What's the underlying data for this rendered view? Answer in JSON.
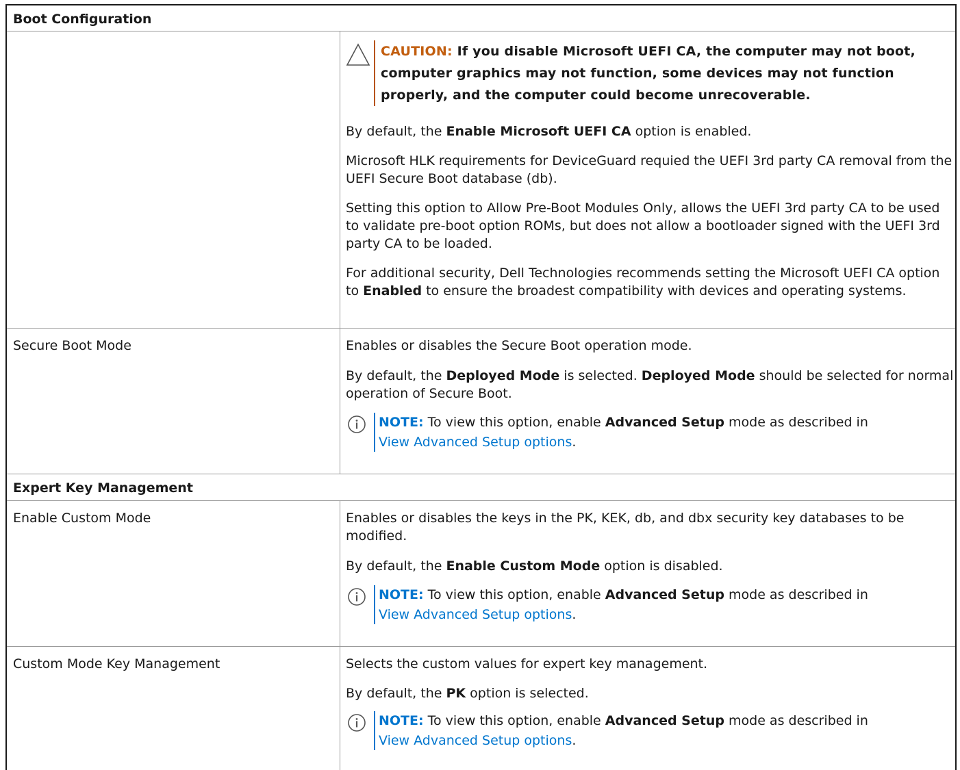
{
  "sections": {
    "boot_config_title": "Boot Configuration",
    "expert_key_title": "Expert Key Management"
  },
  "microsoft_uefi": {
    "caution_label": "CAUTION:",
    "caution_text": "If you disable Microsoft UEFI CA, the computer may not boot, computer graphics may not function, some devices may not function properly, and the computer could become unrecoverable.",
    "p1_pre": "By default, the ",
    "p1_bold": "Enable Microsoft UEFI CA",
    "p1_post": " option is enabled.",
    "p2": "Microsoft HLK requirements for DeviceGuard requied the UEFI 3rd party CA removal from the UEFI Secure Boot database (db).",
    "p3": "Setting this option to Allow Pre-Boot Modules Only, allows the UEFI 3rd party CA to be used to validate pre-boot option ROMs, but does not allow a bootloader signed with the UEFI 3rd party CA to be loaded.",
    "p4_pre": "For additional security, Dell Technologies recommends setting the Microsoft UEFI CA option to ",
    "p4_bold": "Enabled",
    "p4_post": " to ensure the broadest compatibility with devices and operating systems."
  },
  "secure_boot_mode": {
    "label": "Secure Boot Mode",
    "p1": "Enables or disables the Secure Boot operation mode.",
    "p2_pre": "By default, the ",
    "p2_bold1": "Deployed Mode",
    "p2_mid": " is selected. ",
    "p2_bold2": "Deployed Mode",
    "p2_post": " should be selected for normal operation of Secure Boot."
  },
  "custom_mode": {
    "label": "Enable Custom Mode",
    "p1": "Enables or disables the keys in the PK, KEK, db, and dbx security key databases to be modified.",
    "p2_pre": "By default, the ",
    "p2_bold": "Enable Custom Mode",
    "p2_post": " option is disabled."
  },
  "custom_key_mgmt": {
    "label": "Custom Mode Key Management",
    "p1": "Selects the custom values for expert key management.",
    "p2_pre": "By default, the ",
    "p2_bold": "PK",
    "p2_post": " option is selected."
  },
  "note": {
    "label": "NOTE:",
    "pre": " To view this option, enable ",
    "bold": "Advanced Setup",
    "post": " mode as described in",
    "link": "View Advanced Setup options",
    "end": "."
  },
  "colors": {
    "caution": "#c25e0f",
    "note": "#0076ce",
    "link": "#0076ce"
  }
}
